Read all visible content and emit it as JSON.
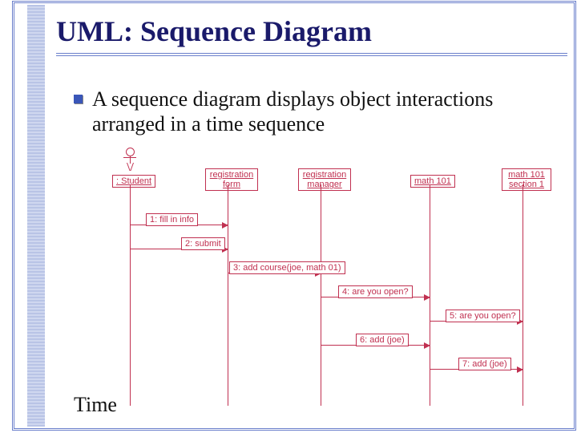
{
  "title": "UML: Sequence Diagram",
  "bullet": "A sequence diagram displays object interactions arranged in a time sequence",
  "time_label": "Time",
  "participants": {
    "p1": ": Student",
    "p2_l1": "registration",
    "p2_l2": "form",
    "p3_l1": "registration",
    "p3_l2": "manager",
    "p4": "math 101",
    "p5_l1": "math 101",
    "p5_l2": "section 1"
  },
  "messages": {
    "m1": "1: fill in info",
    "m2": "2: submit",
    "m3": "3: add course(joe, math 01)",
    "m4": "4: are you open?",
    "m5": "5: are you open?",
    "m6": "6: add (joe)",
    "m7": "7: add (joe)"
  }
}
